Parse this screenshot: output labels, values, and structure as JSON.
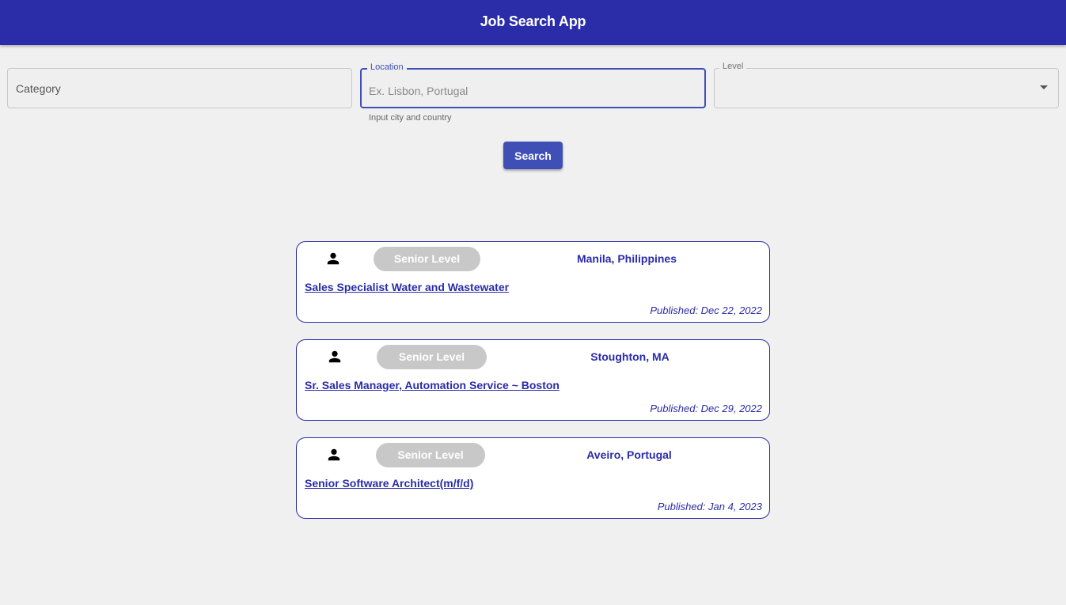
{
  "app": {
    "title": "Job Search App"
  },
  "filters": {
    "category": {
      "placeholder": "Category"
    },
    "location": {
      "label": "Location",
      "placeholder": "Ex. Lisbon, Portugal",
      "hint": "Input city and country"
    },
    "level": {
      "label": "Level",
      "value": ""
    }
  },
  "search_button": "Search",
  "colors": {
    "primary": "#2a2ca8",
    "button": "#3f4fb6",
    "badge": "#c8c8c8"
  },
  "jobs": [
    {
      "level": "Senior Level",
      "location": "Manila, Philippines",
      "title": "Sales Specialist Water and Wastewater",
      "published": "Published: Dec 22, 2022"
    },
    {
      "level": "Senior Level",
      "location": "Stoughton, MA",
      "title": "Sr. Sales Manager, Automation Service ~ Boston",
      "published": "Published: Dec 29, 2022"
    },
    {
      "level": "Senior Level",
      "location": "Aveiro, Portugal",
      "title": "Senior Software Architect(m/f/d)",
      "published": "Published: Jan 4, 2023"
    }
  ]
}
